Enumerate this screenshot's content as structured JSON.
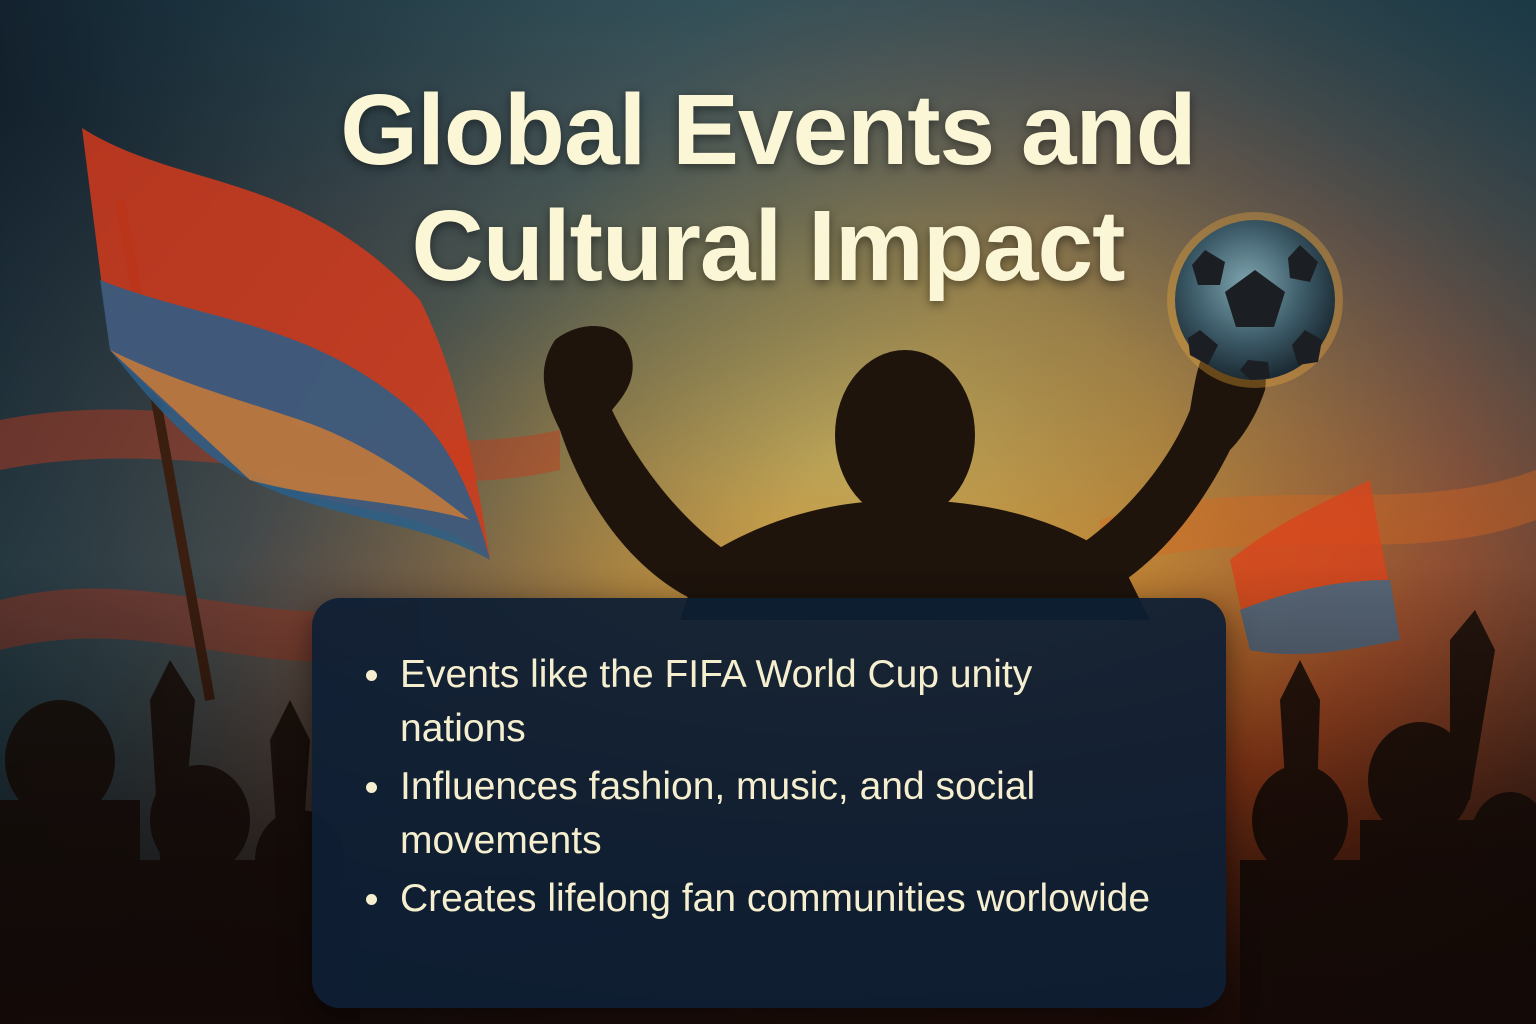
{
  "slide": {
    "title_line_1": "Global Events and",
    "title_line_2": "Cultural Impact",
    "bullets": [
      {
        "text": "Events like the FIFA World Cup unity nations"
      },
      {
        "text": "Influences fashion, music, and social movements"
      },
      {
        "text": "Creates lifelong fan communities worlowide"
      }
    ]
  },
  "colors": {
    "title_text": "#fbf6d6",
    "card_background": "#0e1f34",
    "bullet_text": "#f5efcf",
    "sky_orange": "#e8841c",
    "sky_teal": "#2f6a78",
    "silhouette": "#1e140c"
  },
  "illustration": {
    "icons": [
      "raised-fist-icon",
      "soccer-ball-icon",
      "waving-flag-icon",
      "crowd-silhouette-icon"
    ]
  }
}
